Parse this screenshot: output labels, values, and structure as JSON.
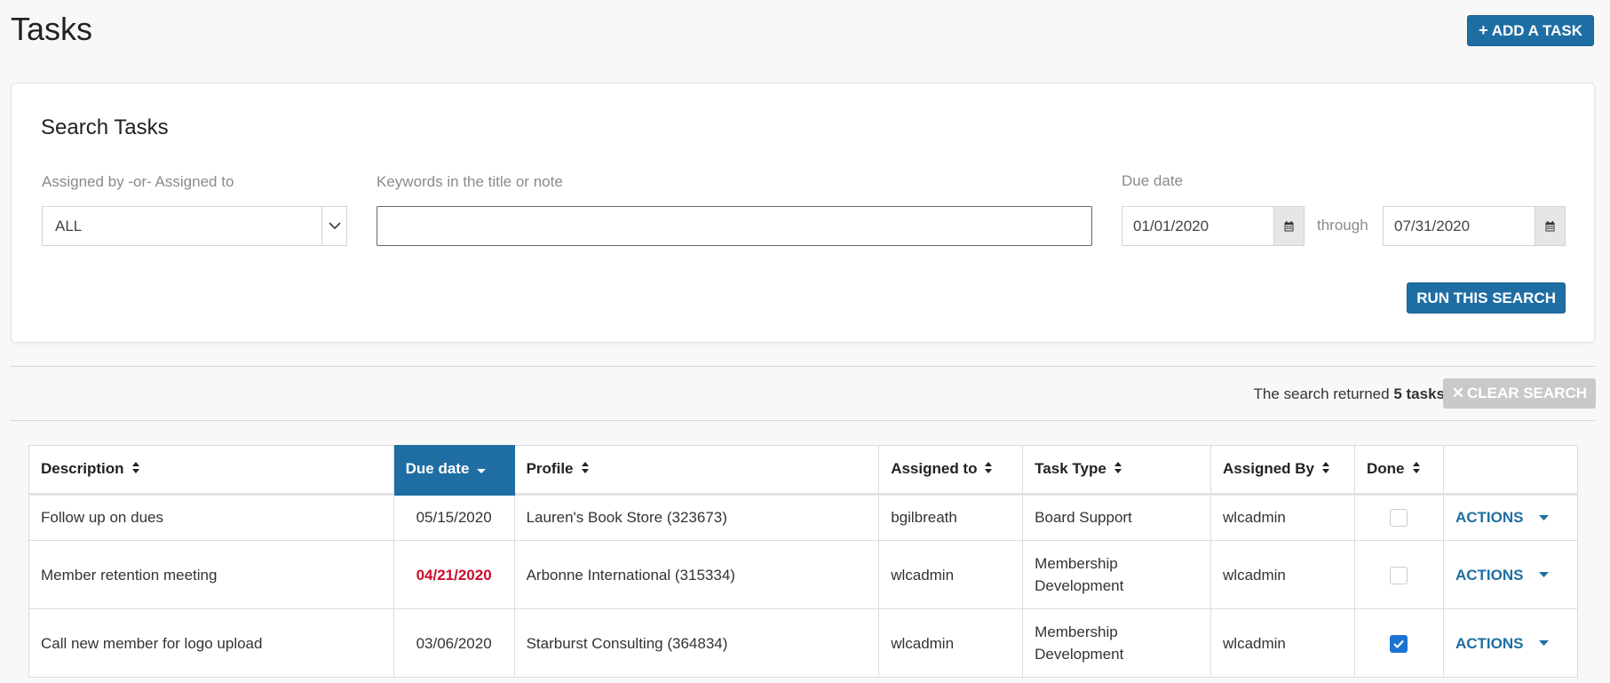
{
  "header": {
    "title": "Tasks",
    "add_button": "ADD A TASK"
  },
  "search": {
    "title": "Search Tasks",
    "assigned_label": "Assigned by -or- Assigned to",
    "assigned_value": "ALL",
    "keywords_label": "Keywords in the title or note",
    "keywords_value": "",
    "due_label": "Due date",
    "due_from": "01/01/2020",
    "through_label": "through",
    "due_to": "07/31/2020",
    "run_button": "RUN THIS SEARCH"
  },
  "results": {
    "prefix": "The search returned",
    "count": "5 tasks",
    "clear_button": "CLEAR SEARCH"
  },
  "table": {
    "columns": [
      "Description",
      "Due date",
      "Profile",
      "Assigned to",
      "Task Type",
      "Assigned By",
      "Done",
      ""
    ],
    "active_column": "Due date",
    "actions_label": "ACTIONS",
    "rows": [
      {
        "description": "Follow up on dues",
        "due": "05/15/2020",
        "overdue": false,
        "profile": "Lauren's Book Store (323673)",
        "assigned_to": "bgilbreath",
        "task_type": "Board Support",
        "assigned_by": "wlcadmin",
        "done": false
      },
      {
        "description": "Member retention meeting",
        "due": "04/21/2020",
        "overdue": true,
        "profile": "Arbonne International (315334)",
        "assigned_to": "wlcadmin",
        "task_type": "Membership Development",
        "assigned_by": "wlcadmin",
        "done": false
      },
      {
        "description": "Call new member for logo upload",
        "due": "03/06/2020",
        "overdue": false,
        "profile": "Starburst Consulting (364834)",
        "assigned_to": "wlcadmin",
        "task_type": "Membership Development",
        "assigned_by": "wlcadmin",
        "done": true
      }
    ]
  },
  "colors": {
    "primary": "#1f6ea3",
    "overdue": "#c8102e",
    "checkbox": "#1b73d1",
    "disabled": "#c9c9c9"
  },
  "icons": {
    "add": "plus-icon",
    "select": "chevron-down-icon",
    "calendar": "calendar-icon",
    "sort": "sort-icon",
    "sort_desc": "sort-desc-icon",
    "clear": "close-icon",
    "actions": "caret-down-icon",
    "check": "checkmark-icon"
  }
}
